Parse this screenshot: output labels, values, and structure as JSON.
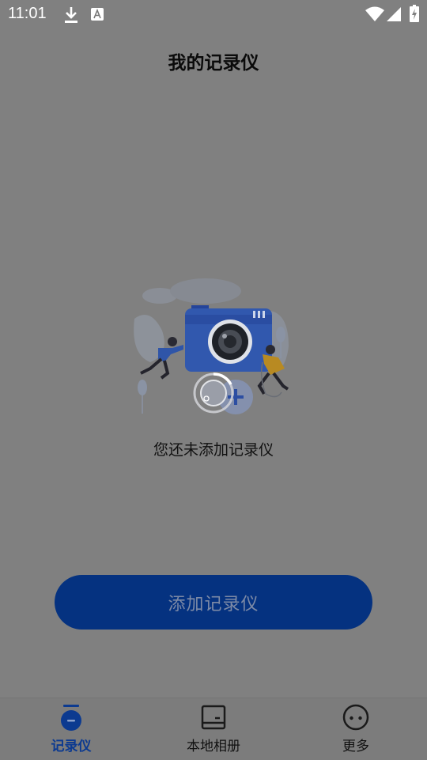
{
  "status_bar": {
    "time": "11:01"
  },
  "page_title": "我的记录仪",
  "empty_state": {
    "message": "您还未添加记录仪"
  },
  "add_button_label": "添加记录仪",
  "bottom_nav": {
    "items": [
      {
        "label": "记录仪",
        "icon": "recorder-icon",
        "active": true
      },
      {
        "label": "本地相册",
        "icon": "album-icon",
        "active": false
      },
      {
        "label": "更多",
        "icon": "more-icon",
        "active": false
      }
    ]
  },
  "colors": {
    "overlay_background": "#808080",
    "primary_button": "#053280",
    "active_nav": "#0c3a90"
  }
}
